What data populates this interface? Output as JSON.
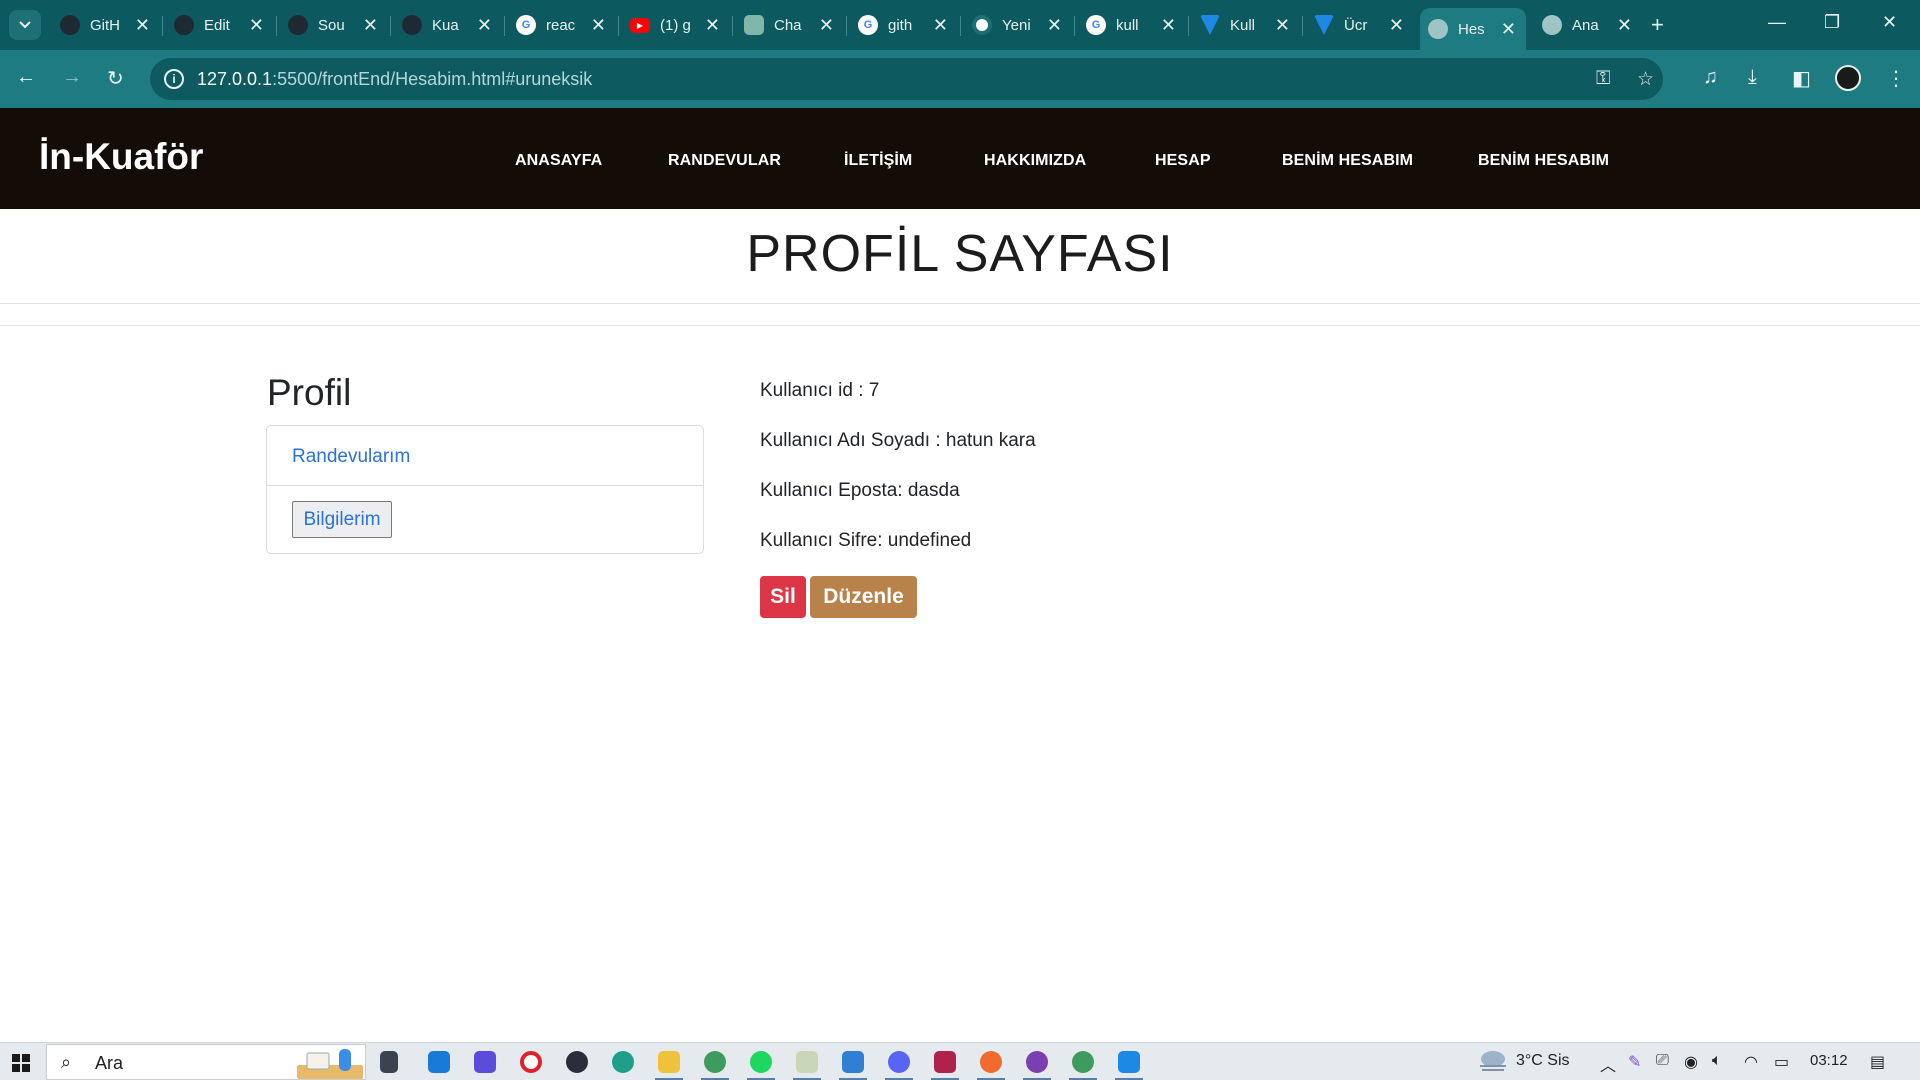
{
  "browser": {
    "tabs": [
      {
        "title": "GitH",
        "icon": "github-icon",
        "color": "#1f2933"
      },
      {
        "title": "Edit",
        "icon": "github-icon",
        "color": "#1f2933"
      },
      {
        "title": "Sou",
        "icon": "github-icon",
        "color": "#1f2933"
      },
      {
        "title": "Kua",
        "icon": "github-icon",
        "color": "#1f2933"
      },
      {
        "title": "reac",
        "icon": "google-icon",
        "color": "#ffffff"
      },
      {
        "title": "(1) g",
        "icon": "youtube-icon",
        "color": "#ff0000"
      },
      {
        "title": "Cha",
        "icon": "chatgpt-icon",
        "color": "#7fb7a9"
      },
      {
        "title": "gith",
        "icon": "google-icon",
        "color": "#ffffff"
      },
      {
        "title": "Yeni",
        "icon": "chrome-icon",
        "color": "#ffffff"
      },
      {
        "title": "kull",
        "icon": "google-icon",
        "color": "#ffffff"
      },
      {
        "title": "Kull",
        "icon": "vuetify-icon",
        "color": "#1e88e5"
      },
      {
        "title": "Ücr",
        "icon": "vuetify-icon",
        "color": "#1e88e5"
      },
      {
        "title": "Hes",
        "icon": "globe-icon",
        "color": "#9fc4c6",
        "active": true
      },
      {
        "title": "Ana",
        "icon": "globe-icon",
        "color": "#9fc4c6"
      }
    ],
    "url_host": "127.0.0.1",
    "url_rest": ":5500/frontEnd/Hesabim.html#uruneksik"
  },
  "site": {
    "brand": "İn-Kuaför",
    "nav": [
      "ANASAYFA",
      "RANDEVULAR",
      "İLETİŞİM",
      "HAKKIMIZDA",
      "HESAP",
      "BENİM HESABIM",
      "BENİM HESABIM"
    ]
  },
  "page": {
    "title": "PROFİL SAYFASI"
  },
  "sidebar": {
    "title": "Profil",
    "link": "Randevularım",
    "button": "Bilgilerim"
  },
  "profile": {
    "id_line": "Kullanıcı id : 7",
    "name_line": "Kullanıcı Adı Soyadı : hatun kara",
    "email_line": "Kullanıcı Eposta: dasda",
    "password_line": "Kullanıcı Sifre: undefined",
    "delete_label": "Sil",
    "edit_label": "Düzenle"
  },
  "taskbar": {
    "search_placeholder": "Ara",
    "weather": "3°C  Sis",
    "time": "03:12"
  },
  "colors": {
    "tabstrip": "#0c5a60",
    "toolbar": "#1e7b81",
    "navbar": "#140d07",
    "delete": "#dc3545",
    "edit": "#b8824a",
    "link": "#2a72d8"
  }
}
